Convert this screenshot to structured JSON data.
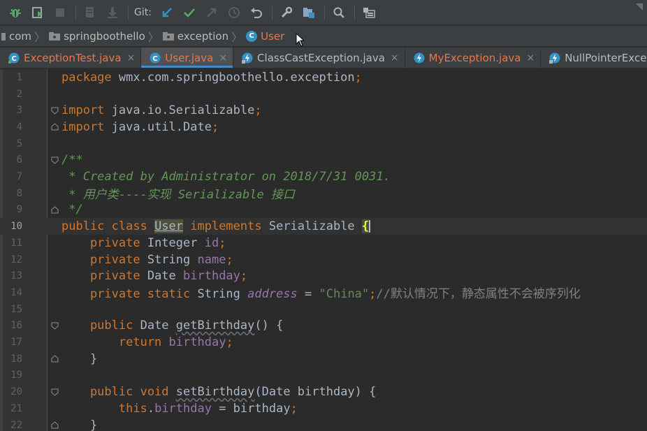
{
  "toolbar": {
    "git_label": "Git:",
    "icons": [
      "debug-icon",
      "run-coverage-icon",
      "stop-icon",
      "vcs-history-icon",
      "vcs-download-icon",
      "git-update-icon",
      "git-commit-icon",
      "git-push-icon",
      "git-history-icon",
      "rollback-icon",
      "wrench-icon",
      "project-structure-icon",
      "search-icon",
      "layout-icon"
    ]
  },
  "breadcrumb": {
    "items": [
      {
        "label": "com",
        "icon": "folder-icon"
      },
      {
        "label": "springboothello",
        "icon": "folder-icon"
      },
      {
        "label": "exception",
        "icon": "folder-icon"
      },
      {
        "label": "User",
        "icon": "class-icon",
        "class_letter": "C"
      }
    ]
  },
  "tabs": [
    {
      "label": "ExceptionTest.java",
      "icon": "class-icon",
      "color": "#e8784a",
      "close": "×"
    },
    {
      "label": "User.java",
      "icon": "class-icon",
      "color": "#e8784a",
      "close": "×",
      "active": true
    },
    {
      "label": "ClassCastException.java",
      "icon": "exception-class-icon",
      "color": "#bbbbbb",
      "close": "×"
    },
    {
      "label": "MyException.java",
      "icon": "exception-class-icon",
      "color": "#e8784a",
      "close": "×"
    },
    {
      "label": "NullPointerExceptic",
      "icon": "exception-class-icon",
      "color": "#bbbbbb",
      "close": ""
    }
  ],
  "editor": {
    "current_line": 10,
    "lines": [
      {
        "no": "1",
        "text": "package wmx.com.springboothello.exception;"
      },
      {
        "no": "2",
        "text": ""
      },
      {
        "no": "3",
        "text": "import java.io.Serializable;"
      },
      {
        "no": "4",
        "text": "import java.util.Date;"
      },
      {
        "no": "5",
        "text": ""
      },
      {
        "no": "6",
        "text": "/**"
      },
      {
        "no": "7",
        "text": " * Created by Administrator on 2018/7/31 0031."
      },
      {
        "no": "8",
        "text": " * 用户类----实现 Serializable 接口"
      },
      {
        "no": "9",
        "text": " */"
      },
      {
        "no": "10",
        "text": "public class User implements Serializable {"
      },
      {
        "no": "11",
        "text": "    private Integer id;"
      },
      {
        "no": "12",
        "text": "    private String name;"
      },
      {
        "no": "13",
        "text": "    private Date birthday;"
      },
      {
        "no": "14",
        "text": "    private static String address = \"China\";//默认情况下，静态属性不会被序列化"
      },
      {
        "no": "15",
        "text": ""
      },
      {
        "no": "16",
        "text": "    public Date getBirthday() {"
      },
      {
        "no": "17",
        "text": "        return birthday;"
      },
      {
        "no": "18",
        "text": "    }"
      },
      {
        "no": "19",
        "text": ""
      },
      {
        "no": "20",
        "text": "    public void setBirthday(Date birthday) {"
      },
      {
        "no": "21",
        "text": "        this.birthday = birthday;"
      },
      {
        "no": "22",
        "text": "    }"
      }
    ],
    "tokens": {
      "l1_kw": "package",
      "l1_rest": " wmx.com.springboothello.exception",
      "l1_semi": ";",
      "l3_kw": "import",
      "l3_rest": " java.io.Serializable",
      "l3_semi": ";",
      "l4_kw": "import",
      "l4_rest": " java.util.Date",
      "l4_semi": ";",
      "l6": "/**",
      "l7": " * Created by Administrator on 2018/7/31 0031.",
      "l8": " * 用户类----实现 Serializable 接口",
      "l9": " */",
      "l10_kw1": "public class ",
      "l10_cls": "User",
      "l10_kw2": " implements",
      "l10_rest": " Serializable ",
      "l10_brace": "{",
      "l11_kw": "    private",
      "l11_type": " Integer ",
      "l11_field": "id",
      "l11_semi": ";",
      "l12_kw": "    private",
      "l12_type": " String ",
      "l12_field": "name",
      "l12_semi": ";",
      "l13_kw": "    private",
      "l13_type": " Date ",
      "l13_field": "birthday",
      "l13_semi": ";",
      "l14_kw": "    private static",
      "l14_type": " String ",
      "l14_field": "address",
      "l14_eq": " = ",
      "l14_str": "\"China\"",
      "l14_semi": ";",
      "l14_comment": "//默认情况下，静态属性不会被序列化",
      "l16_kw": "    public",
      "l16_type": " Date ",
      "l16_method": "getBirthday",
      "l16_rest": "() {",
      "l17_kw": "        return",
      "l17_sp": " ",
      "l17_field": "birthday",
      "l17_semi": ";",
      "l18": "    }",
      "l20_kw": "    public void",
      "l20_sp": " ",
      "l20_method": "setBirthday",
      "l20_rest": "(Date birthday) {",
      "l21_kw": "        this",
      "l21_dot": ".",
      "l21_field": "birthday",
      "l21_rest": " = birthday",
      "l21_semi": ";",
      "l22": "    }"
    }
  },
  "colors": {
    "keyword": "#cc7832",
    "field": "#9876aa",
    "string": "#6a8759",
    "comment": "#808080",
    "doc_comment": "#629755",
    "text": "#a9b7c6",
    "tab_modified": "#e8784a",
    "accent": "#4a88c7"
  }
}
